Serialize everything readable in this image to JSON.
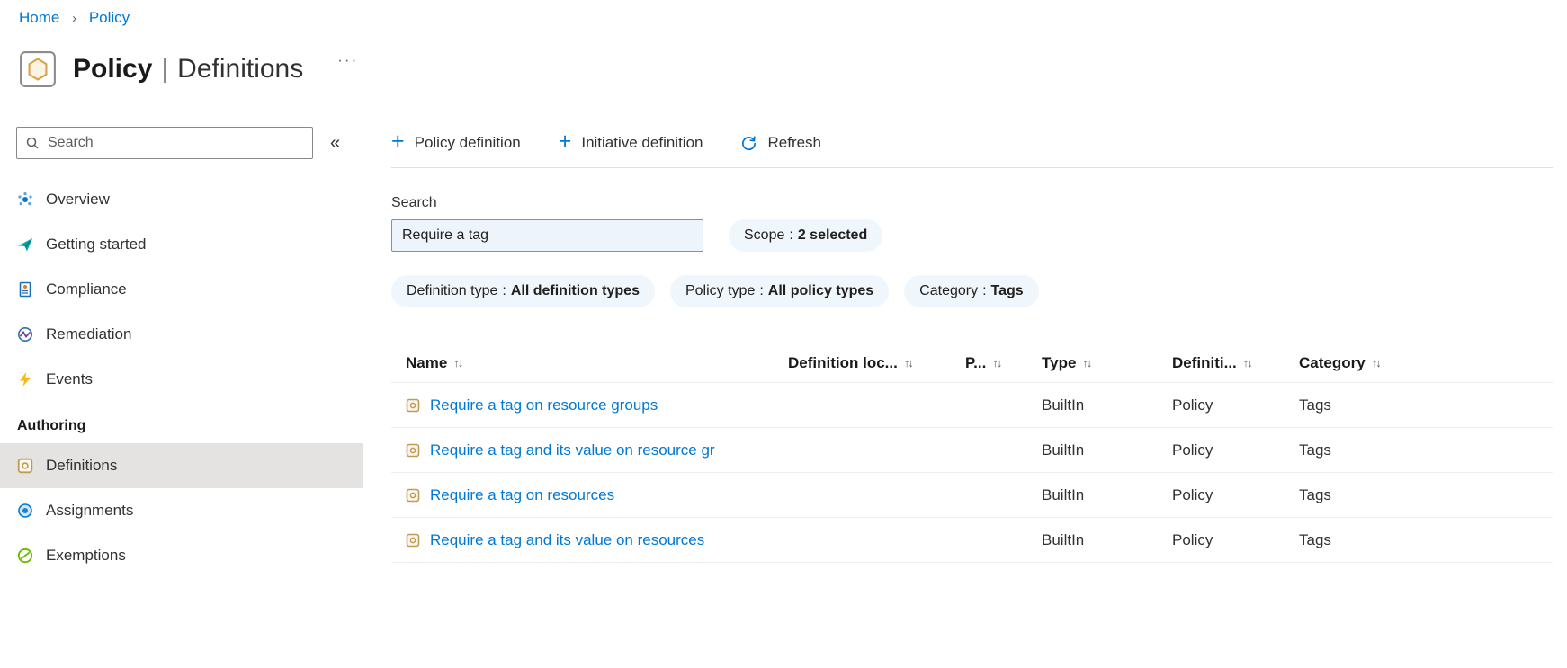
{
  "breadcrumb": {
    "home": "Home",
    "separator": "›",
    "current": "Policy"
  },
  "header": {
    "title_primary": "Policy",
    "title_divider": "|",
    "title_secondary": "Definitions",
    "more_glyph": "···"
  },
  "sidebar": {
    "search_placeholder": "Search",
    "collapse_glyph": "«",
    "items": [
      {
        "label": "Overview"
      },
      {
        "label": "Getting started"
      },
      {
        "label": "Compliance"
      },
      {
        "label": "Remediation"
      },
      {
        "label": "Events"
      }
    ],
    "section_label": "Authoring",
    "authoring_items": [
      {
        "label": "Definitions",
        "selected": true
      },
      {
        "label": "Assignments",
        "selected": false
      },
      {
        "label": "Exemptions",
        "selected": false
      }
    ]
  },
  "toolbar": {
    "plus_glyph": "+",
    "buttons": [
      {
        "label": "Policy definition"
      },
      {
        "label": "Initiative definition"
      },
      {
        "label": "Refresh"
      }
    ]
  },
  "filterbar": {
    "search_label": "Search",
    "search_value": "Require a tag",
    "pills": [
      {
        "name": "Scope",
        "sep": ":",
        "value": "2 selected"
      },
      {
        "name": "Definition type",
        "sep": ":",
        "value": "All definition types"
      },
      {
        "name": "Policy type",
        "sep": ":",
        "value": "All policy types"
      },
      {
        "name": "Category",
        "sep": ":",
        "value": "Tags"
      }
    ]
  },
  "table": {
    "sort_glyph": "↑↓",
    "columns": [
      {
        "label": "Name"
      },
      {
        "label": "Definition loc..."
      },
      {
        "label": "P..."
      },
      {
        "label": "Type"
      },
      {
        "label": "Definiti..."
      },
      {
        "label": "Category"
      }
    ],
    "rows": [
      {
        "name": "Require a tag on resource groups",
        "type": "BuiltIn",
        "definition_type": "Policy",
        "category": "Tags"
      },
      {
        "name": "Require a tag and its value on resource gr",
        "type": "BuiltIn",
        "definition_type": "Policy",
        "category": "Tags"
      },
      {
        "name": "Require a tag on resources",
        "type": "BuiltIn",
        "definition_type": "Policy",
        "category": "Tags"
      },
      {
        "name": "Require a tag and its value on resources",
        "type": "BuiltIn",
        "definition_type": "Policy",
        "category": "Tags"
      }
    ]
  },
  "colors": {
    "accent": "#0078d4",
    "pill_background": "#eff6fc",
    "selected_item_background": "#e5e3e1",
    "events_yellow": "#fdb714",
    "exemptions_green": "#6bb700",
    "definitions_tan": "#c09b52"
  }
}
